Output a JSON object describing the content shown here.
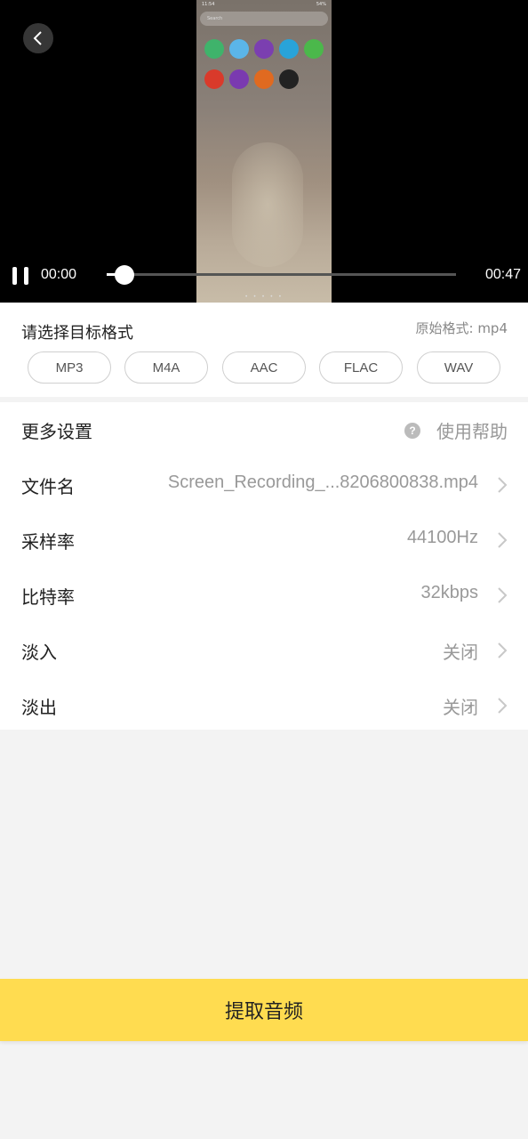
{
  "player": {
    "current_time": "00:00",
    "total_time": "00:47",
    "progress": 0.05,
    "preview": {
      "status_time": "11:54",
      "battery": "54%",
      "search_placeholder": "Search",
      "page_dots": "• • • • •",
      "apps_row1_colors": [
        "#3fb36b",
        "#5bb5e8",
        "#7b3fb0",
        "#29a3d9",
        "#4bb84b"
      ],
      "apps_row2_colors": [
        "#d93a2b",
        "#7a3ab0",
        "#e06a20",
        "#222222"
      ]
    }
  },
  "format_section": {
    "title": "请选择目标格式",
    "original": "原始格式: mp4",
    "options": [
      "MP3",
      "M4A",
      "AAC",
      "FLAC",
      "WAV"
    ]
  },
  "settings": {
    "header": "更多设置",
    "help": "使用帮助",
    "help_icon": "?",
    "rows": [
      {
        "label": "文件名",
        "value": "Screen_Recording_...8206800838.mp4"
      },
      {
        "label": "采样率",
        "value": "44100Hz"
      },
      {
        "label": "比特率",
        "value": "32kbps"
      },
      {
        "label": "淡入",
        "value": "关闭"
      },
      {
        "label": "淡出",
        "value": "关闭"
      }
    ]
  },
  "action": {
    "extract_label": "提取音频"
  },
  "colors": {
    "accent": "#ffdc50",
    "background": "#f3f3f3"
  }
}
